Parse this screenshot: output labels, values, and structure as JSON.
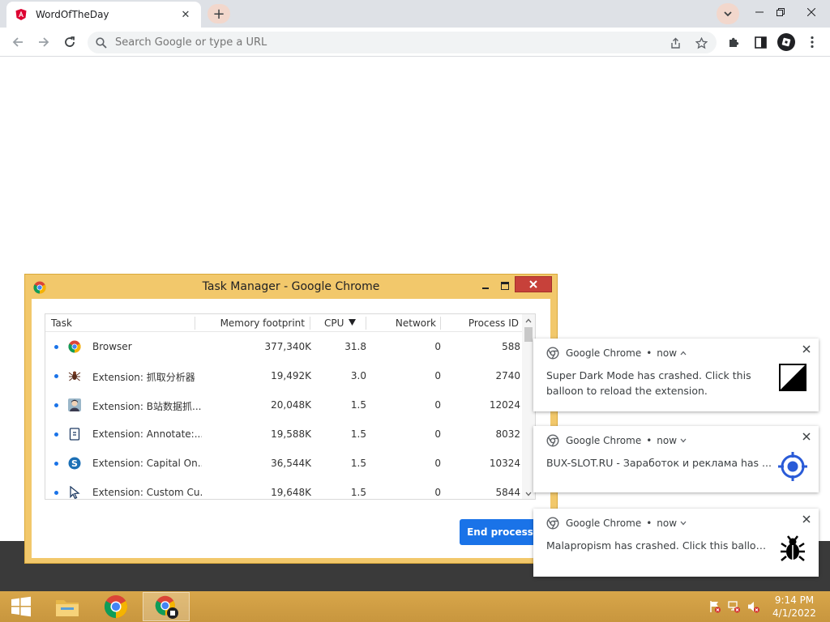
{
  "browser": {
    "tab_title": "WordOfTheDay",
    "omnibox_placeholder": "Search Google or type a URL"
  },
  "task_manager": {
    "title": "Task Manager - Google Chrome",
    "columns": {
      "task": "Task",
      "memory": "Memory footprint",
      "cpu": "CPU",
      "network": "Network",
      "pid": "Process ID"
    },
    "rows": [
      {
        "task": "Browser",
        "memory": "377,340K",
        "cpu": "31.8",
        "network": "0",
        "pid": "588",
        "icon": "chrome-icon"
      },
      {
        "task": "Extension: 抓取分析器",
        "memory": "19,492K",
        "cpu": "3.0",
        "network": "0",
        "pid": "2740",
        "icon": "spider-icon"
      },
      {
        "task": "Extension: B站数据抓...",
        "memory": "20,048K",
        "cpu": "1.5",
        "network": "0",
        "pid": "12024",
        "icon": "avatar-icon"
      },
      {
        "task": "Extension: Annotate:...",
        "memory": "19,588K",
        "cpu": "1.5",
        "network": "0",
        "pid": "8032",
        "icon": "document-icon"
      },
      {
        "task": "Extension: Capital On...",
        "memory": "36,544K",
        "cpu": "1.5",
        "network": "0",
        "pid": "10324",
        "icon": "capital-s-icon"
      },
      {
        "task": "Extension: Custom Cu...",
        "memory": "19,648K",
        "cpu": "1.5",
        "network": "0",
        "pid": "5844",
        "icon": "cursor-icon"
      }
    ],
    "end_process_label": "End process"
  },
  "notifications": [
    {
      "source": "Google Chrome",
      "time": "now",
      "message": "Super Dark Mode has crashed. Click this balloon to reload the extension.",
      "icon": "dark-mode-icon"
    },
    {
      "source": "Google Chrome",
      "time": "now",
      "message": "BUX-SLOT.RU - Заработок и реклама has ...",
      "icon": "target-icon"
    },
    {
      "source": "Google Chrome",
      "time": "now",
      "message": "Malapropism has crashed. Click this balloon to...",
      "icon": "bug-icon"
    }
  ],
  "taskbar": {
    "time": "9:14 PM",
    "date": "4/1/2022"
  },
  "colors": {
    "task_manager_frame": "#f2c86b",
    "taskbar": "#c8963e",
    "accent_blue": "#1a73e8",
    "close_red": "#c7413a"
  }
}
